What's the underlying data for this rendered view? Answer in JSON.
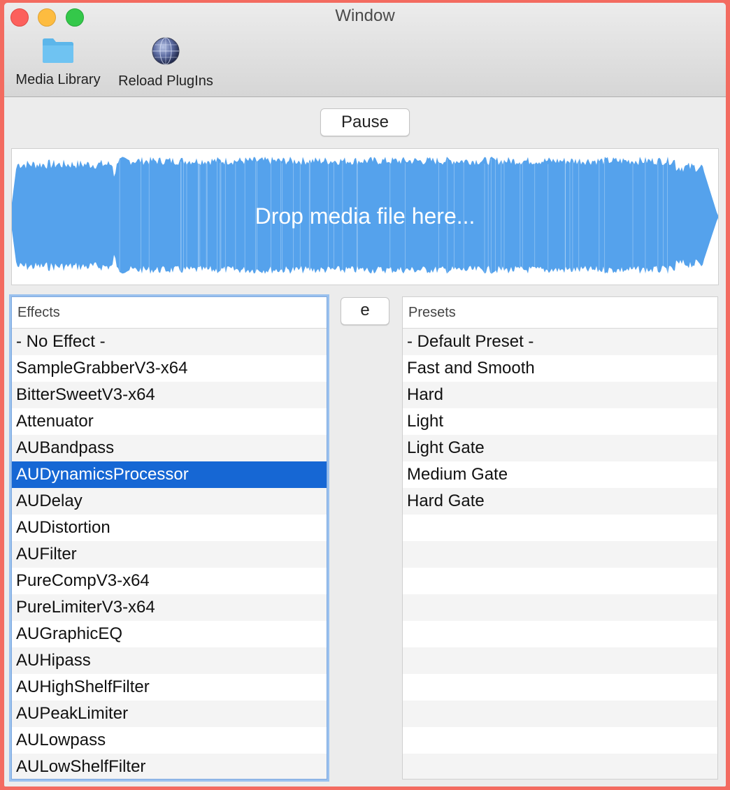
{
  "window": {
    "title": "Window"
  },
  "toolbar": {
    "media_library_label": "Media Library",
    "reload_plugins_label": "Reload PlugIns"
  },
  "transport": {
    "pause_label": "Pause"
  },
  "dropzone": {
    "text": "Drop media file here..."
  },
  "effects": {
    "header": "Effects",
    "items": [
      "- No Effect -",
      "SampleGrabberV3-x64",
      "BitterSweetV3-x64",
      "Attenuator",
      "AUBandpass",
      "AUDynamicsProcessor",
      "AUDelay",
      "AUDistortion",
      "AUFilter",
      "PureCompV3-x64",
      "PureLimiterV3-x64",
      "AUGraphicEQ",
      "AUHipass",
      "AUHighShelfFilter",
      "AUPeakLimiter",
      "AULowpass",
      "AULowShelfFilter"
    ],
    "selected_item": "AUDynamicsProcessor"
  },
  "edit_button": {
    "label": "e"
  },
  "presets": {
    "header": "Presets",
    "items": [
      "- Default Preset -",
      "Fast and Smooth",
      "Hard",
      "Light",
      "Light Gate",
      "Medium Gate",
      "Hard Gate"
    ]
  },
  "colors": {
    "waveform": "#55a2ec",
    "selection": "#1667d4",
    "border_frame": "#f36b60"
  }
}
